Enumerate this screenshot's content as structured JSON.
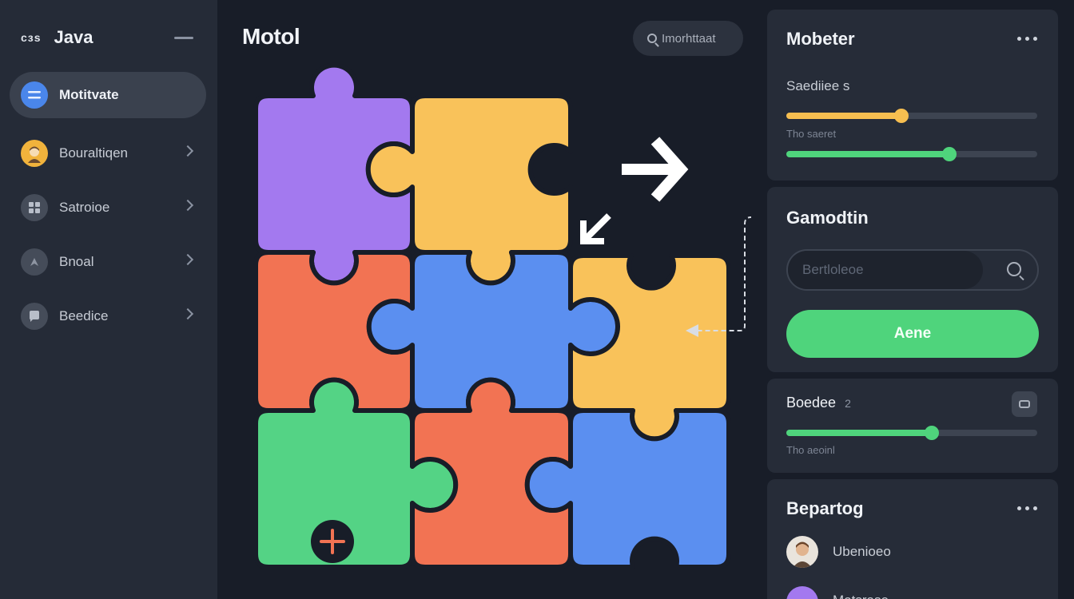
{
  "sidebar": {
    "logo": "cɜs",
    "title": "Java",
    "items": [
      {
        "label": "Motitvate",
        "icon": "list-icon",
        "active": true
      },
      {
        "label": "Bouraltiqen",
        "icon": "avatar-icon"
      },
      {
        "label": "Satroioe",
        "icon": "grid-icon"
      },
      {
        "label": "Bnoal",
        "icon": "compass-icon"
      },
      {
        "label": "Beedice",
        "icon": "chat-icon"
      }
    ]
  },
  "main": {
    "title": "Motol",
    "search_label": "Imorhttaat"
  },
  "panel": {
    "card1": {
      "title": "Mobeter",
      "slider1_label": "Saediiee s",
      "slider1_value": 0.46,
      "slider2_label": "Tho saeret",
      "slider2_value": 0.65
    },
    "card2": {
      "title": "Gamodtin",
      "input_placeholder": "Bertloleoe",
      "button_label": "Aene"
    },
    "card3": {
      "title": "Boedee",
      "badge": "2",
      "slider_label": "Tho aeoinl",
      "slider_value": 0.58
    },
    "card4": {
      "title": "Bepartog",
      "item1_label": "Ubenioeo",
      "item2_label": "Motsrase"
    }
  },
  "colors": {
    "purple": "#a379ef",
    "yellow": "#f9c25a",
    "orange": "#f27353",
    "blue": "#5b8ff0",
    "green": "#54d385",
    "accent_green": "#4fd47c",
    "accent_yellow": "#f6be50"
  }
}
